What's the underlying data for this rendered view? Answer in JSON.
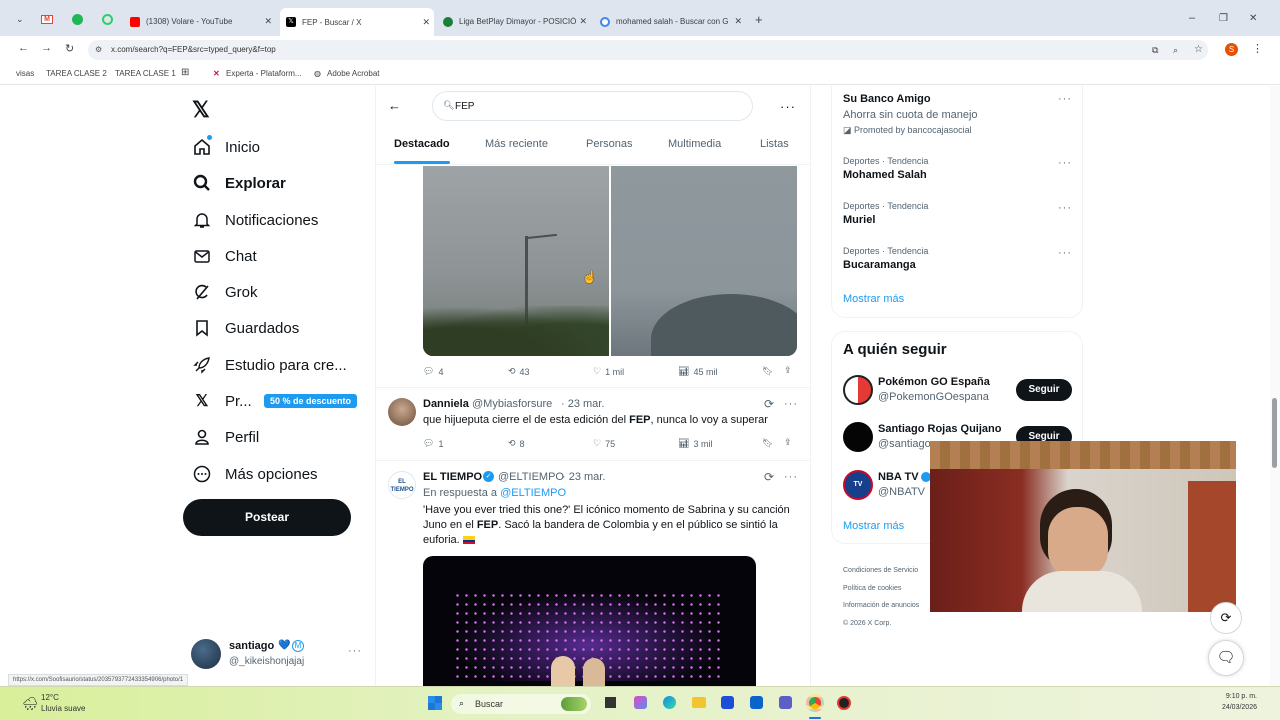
{
  "browser": {
    "tabs": [
      {
        "label": "(1308) Volare - YouTube",
        "color": "#ff0000"
      },
      {
        "label": "FEP - Buscar / X",
        "color": "#000000"
      },
      {
        "label": "Liga BetPlay Dimayor - POSICIÓ",
        "color": "#1a7f37"
      },
      {
        "label": "mohamed salah - Buscar con G",
        "color": "#4285f4"
      }
    ],
    "url": "x.com/search?q=FEP&src=typed_query&f=top",
    "bookmarks": [
      "visas",
      "TAREA CLASE 2",
      "TAREA CLASE 1",
      "Experta - Plataform...",
      "Adobe Acrobat"
    ],
    "profile_initial": "S",
    "status_url": "https://x.com/Soofisaurio/status/2035793772433354906/photo/1"
  },
  "sidebar": {
    "items": [
      {
        "label": "Inicio"
      },
      {
        "label": "Explorar"
      },
      {
        "label": "Notificaciones"
      },
      {
        "label": "Chat"
      },
      {
        "label": "Grok"
      },
      {
        "label": "Guardados"
      },
      {
        "label": "Estudio para cre..."
      },
      {
        "label": "Pr..."
      },
      {
        "label": "Perfil"
      },
      {
        "label": "Más opciones"
      }
    ],
    "premium_badge": "50 % de descuento",
    "post_button": "Postear",
    "user": {
      "name": "santiago",
      "handle": "@_kikeishonjajaj"
    }
  },
  "search": {
    "query": "FEP",
    "tabs": [
      "Destacado",
      "Más reciente",
      "Personas",
      "Multimedia",
      "Listas"
    ]
  },
  "tweets": [
    {
      "replies": "4",
      "retweets": "43",
      "likes": "1 mil",
      "views": "45 mil"
    },
    {
      "name": "Danniela",
      "handle": "@Mybiasforsure",
      "date": "· 23 mar.",
      "text_before": "que hijueputa cierre el de esta edición del ",
      "text_bold": "FEP",
      "text_after": ", nunca lo voy a superar",
      "replies": "1",
      "retweets": "8",
      "likes": "75",
      "views": "3 mil"
    },
    {
      "name": "EL TIEMPO",
      "handle": "@ELTIEMPO",
      "date": "· 23 mar.",
      "reply_prefix": "En respuesta a ",
      "reply_to": "@ELTIEMPO",
      "text_before": "'Have you ever tried this one?' El icónico momento de Sabrina y su canción Juno en el ",
      "text_bold": "FEP",
      "text_after": ". Sacó la bandera de Colombia y en el público se sintió la euforia.",
      "avatar_text": "EL TIEMPO"
    }
  ],
  "right": {
    "ad": {
      "title": "Su Banco Amigo",
      "subtitle": "Ahorra sin cuota de manejo",
      "promoted": "Promoted by bancocajasocial"
    },
    "trends": [
      {
        "meta": "Deportes · Tendencia",
        "name": "Mohamed Salah"
      },
      {
        "meta": "Deportes · Tendencia",
        "name": "Muriel"
      },
      {
        "meta": "Deportes · Tendencia",
        "name": "Bucaramanga"
      }
    ],
    "show_more": "Mostrar más",
    "who_to_follow_title": "A quién seguir",
    "follow": [
      {
        "name": "Pokémon GO España",
        "handle": "@PokemonGOespana",
        "button": "Seguir"
      },
      {
        "name": "Santiago Rojas Quijano",
        "handle": "@santiago",
        "button": "Seguir"
      },
      {
        "name": "NBA TV",
        "handle": "@NBATV"
      }
    ],
    "show_more_2": "Mostrar más",
    "footer": [
      "Condiciones de Servicio",
      "Política de cookies",
      "Información de anuncios",
      "© 2026 X Corp."
    ]
  },
  "taskbar": {
    "weather_temp": "12°C",
    "weather_desc": "Lluvia suave",
    "search": "Buscar",
    "time": "9:10 p. m.",
    "date": "24/03/2026"
  },
  "colors": {
    "accent": "#1d9bf0",
    "dark": "#0f1419",
    "muted": "#536471"
  }
}
